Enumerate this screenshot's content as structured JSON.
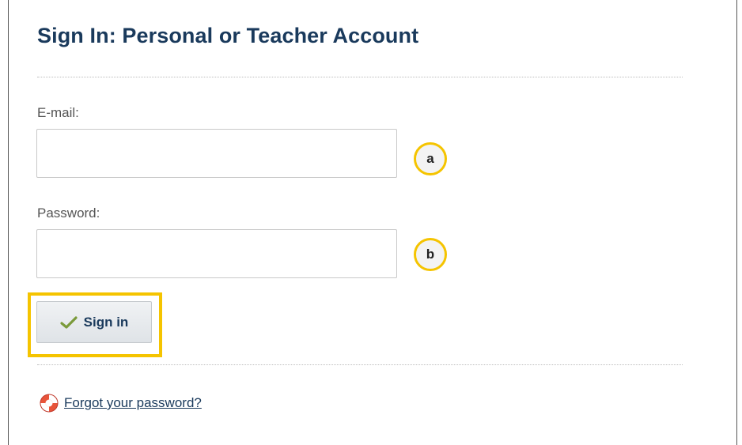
{
  "page": {
    "title": "Sign In: Personal or Teacher Account"
  },
  "form": {
    "email": {
      "label": "E-mail:",
      "value": "",
      "placeholder": ""
    },
    "password": {
      "label": "Password:",
      "value": "",
      "placeholder": ""
    },
    "submit_label": "Sign in",
    "submit_icon": "check-icon"
  },
  "annotations": {
    "email_marker": "a",
    "password_marker": "b",
    "highlight_color": "#f5c400"
  },
  "footer": {
    "forgot_label": "Forgot your password?",
    "forgot_icon": "lifebuoy-icon"
  },
  "colors": {
    "title": "#1a3a5c",
    "link": "#1a3a5c"
  }
}
